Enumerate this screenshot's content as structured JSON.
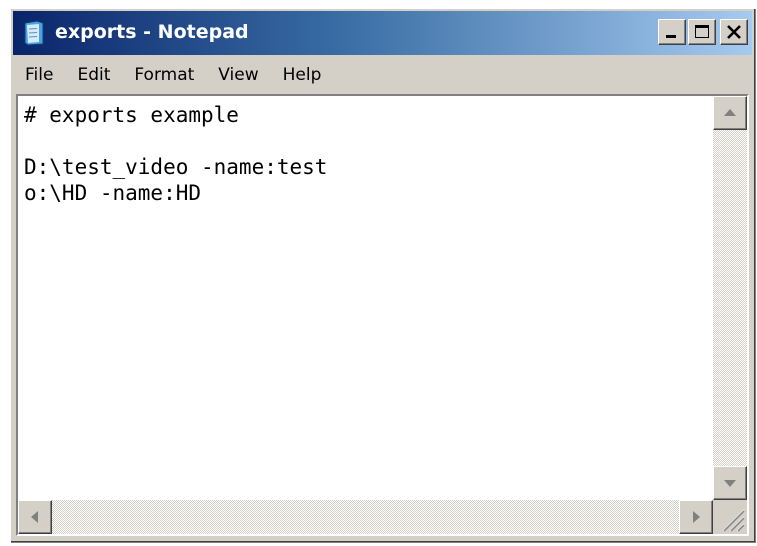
{
  "window": {
    "title": "exports - Notepad"
  },
  "menu": {
    "file": "File",
    "edit": "Edit",
    "format": "Format",
    "view": "View",
    "help": "Help"
  },
  "editor": {
    "lines": [
      "# exports example",
      "",
      "D:\\test_video -name:test",
      "o:\\HD -name:HD"
    ]
  },
  "icons": {
    "app": "notepad-icon",
    "minimize": "minimize-icon",
    "maximize": "maximize-icon",
    "close": "close-icon",
    "scroll_up": "arrow-up-icon",
    "scroll_down": "arrow-down-icon",
    "scroll_left": "arrow-left-icon",
    "scroll_right": "arrow-right-icon",
    "resize_grip": "resize-grip-icon"
  },
  "colors": {
    "titlebar_start": "#0a246a",
    "titlebar_end": "#a6caf0",
    "face": "#d4d0c8"
  }
}
